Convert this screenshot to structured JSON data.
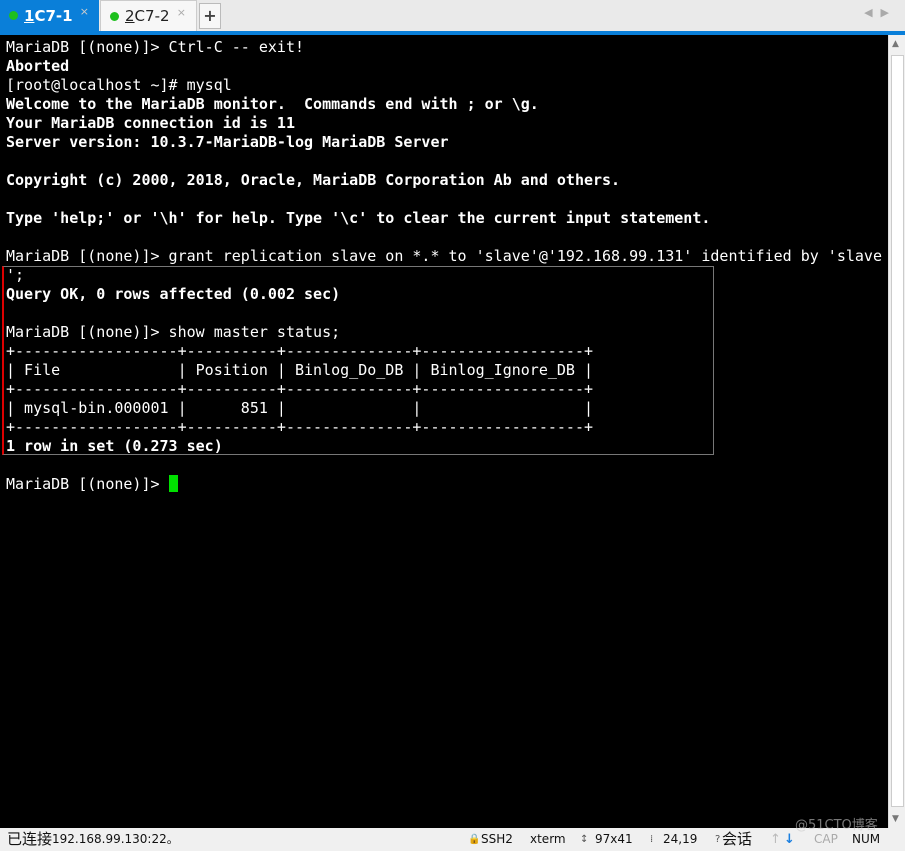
{
  "tabs": [
    {
      "num": "1",
      "label": " C7-1"
    },
    {
      "num": "2",
      "label": " C7-2"
    }
  ],
  "tab_close": "×",
  "new_tab": "+",
  "nav": "◀▶",
  "terminal": {
    "lines": [
      {
        "text": "MariaDB [(none)]> Ctrl-C -- exit!",
        "bold": false
      },
      {
        "text": "Aborted",
        "bold": true
      },
      {
        "text": "[root@localhost ~]# mysql",
        "bold": false
      },
      {
        "text": "Welcome to the MariaDB monitor.  Commands end with ; or \\g.",
        "bold": true
      },
      {
        "text": "Your MariaDB connection id is 11",
        "bold": true
      },
      {
        "text": "Server version: 10.3.7-MariaDB-log MariaDB Server",
        "bold": true
      },
      {
        "text": "",
        "bold": false
      },
      {
        "text": "Copyright (c) 2000, 2018, Oracle, MariaDB Corporation Ab and others.",
        "bold": true
      },
      {
        "text": "",
        "bold": false
      },
      {
        "text": "Type 'help;' or '\\h' for help. Type '\\c' to clear the current input statement.",
        "bold": true
      },
      {
        "text": "",
        "bold": false
      },
      {
        "text": "MariaDB [(none)]> grant replication slave on *.* to 'slave'@'192.168.99.131' identified by 'slave",
        "bold": false
      },
      {
        "text": "';",
        "bold": false
      },
      {
        "text": "Query OK, 0 rows affected (0.002 sec)",
        "bold": true
      },
      {
        "text": "",
        "bold": false
      },
      {
        "text": "MariaDB [(none)]> show master status;",
        "bold": false
      },
      {
        "text": "+------------------+----------+--------------+------------------+",
        "bold": false
      },
      {
        "text": "| File             | Position | Binlog_Do_DB | Binlog_Ignore_DB |",
        "bold": false
      },
      {
        "text": "+------------------+----------+--------------+------------------+",
        "bold": false
      },
      {
        "text": "| mysql-bin.000001 |      851 |              |                  |",
        "bold": false
      },
      {
        "text": "+------------------+----------+--------------+------------------+",
        "bold": false
      },
      {
        "text": "1 row in set (0.273 sec)",
        "bold": true
      },
      {
        "text": "",
        "bold": false
      }
    ],
    "prompt": "MariaDB [(none)]> ",
    "cursor_color": "#00e000"
  },
  "status": {
    "connected": "已连接",
    "host": " 192.168.99.130:22。",
    "protocol": "SSH2",
    "term": "xterm",
    "size": "97x41",
    "pos": "24,19",
    "sessions": "会话",
    "cap": "CAP",
    "num": "NUM",
    "watermark": "@51CTO博客"
  },
  "colors": {
    "accent": "#0a7fd9",
    "highlight_border": "#dd0000"
  }
}
